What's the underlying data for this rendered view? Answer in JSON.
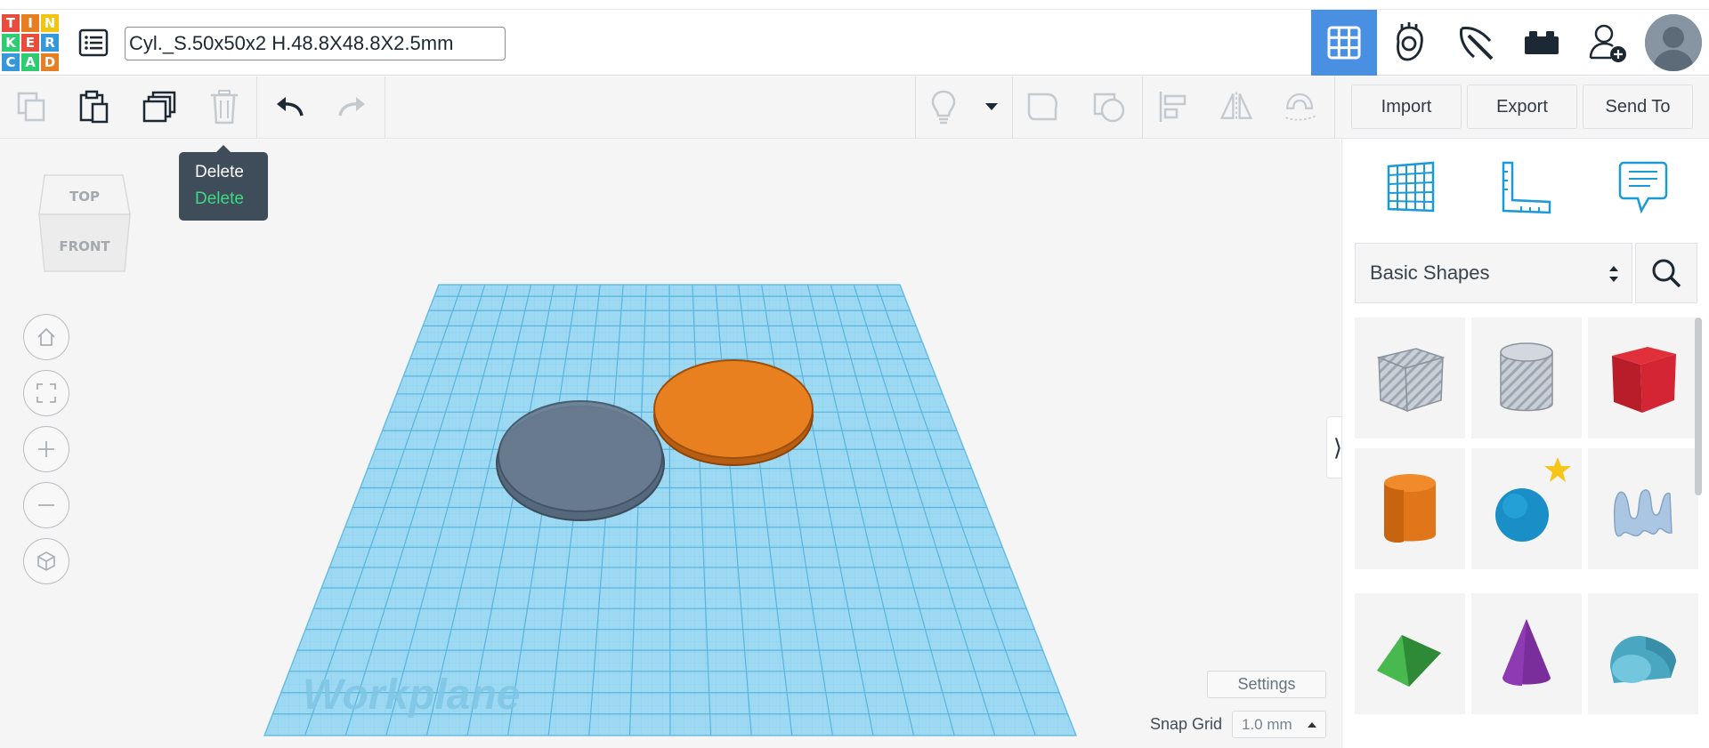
{
  "app": {
    "logo_letters": [
      "T",
      "I",
      "N",
      "K",
      "E",
      "R",
      "C",
      "A",
      "D"
    ],
    "logo_colors": [
      "#e74c3c",
      "#e67e22",
      "#f1c40f",
      "#2ecc71",
      "#e74c3c",
      "#3498db",
      "#3498db",
      "#2ecc71",
      "#e67e22"
    ]
  },
  "header": {
    "design_title": "Cyl._S.50x50x2 H.48.8X48.8X2.5mm",
    "view_buttons": [
      "3d-design-grid-icon",
      "circuits-hand-icon",
      "minecraft-pickaxe-icon",
      "bricks-icon"
    ],
    "accent_color": "#4a90e2"
  },
  "toolbar": {
    "import_label": "Import",
    "export_label": "Export",
    "send_to_label": "Send To"
  },
  "tooltip": {
    "title": "Delete",
    "subtitle": "Delete"
  },
  "viewcube": {
    "top_label": "TOP",
    "front_label": "FRONT"
  },
  "workplane": {
    "label": "Workplane",
    "color": "#8fd3f0",
    "shapes": [
      {
        "name": "hole-cylinder",
        "color": "#5a6e82"
      },
      {
        "name": "solid-cylinder",
        "color": "#e67e22"
      }
    ]
  },
  "canvas": {
    "settings_label": "Settings",
    "snap_grid_label": "Snap Grid",
    "snap_grid_value": "1.0 mm"
  },
  "panel": {
    "library_select": "Basic Shapes",
    "shapes": [
      "box-hole",
      "cylinder-hole",
      "box",
      "cylinder",
      "sphere",
      "scribble",
      "roof",
      "cone",
      "round-roof"
    ]
  }
}
